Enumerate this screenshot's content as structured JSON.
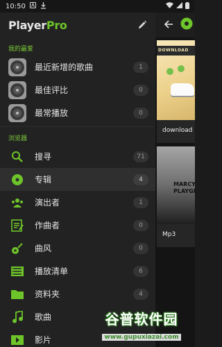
{
  "status_bar": {
    "time": "10:50"
  },
  "drawer": {
    "logo": {
      "part1": "Player",
      "part2": "Pro"
    },
    "sections": {
      "favorites_title": "我的最爱",
      "browser_title": "浏览器"
    },
    "favorites": [
      {
        "label": "最近新增的歌曲",
        "count": "1",
        "icon": "vinyl-icon"
      },
      {
        "label": "最佳评比",
        "count": "0",
        "icon": "vinyl-icon"
      },
      {
        "label": "最常播放",
        "count": "0",
        "icon": "vinyl-icon"
      }
    ],
    "browser": [
      {
        "label": "搜寻",
        "count": "71",
        "icon": "search-icon"
      },
      {
        "label": "专辑",
        "count": "4",
        "icon": "album-icon"
      },
      {
        "label": "演出者",
        "count": "1",
        "icon": "artists-icon"
      },
      {
        "label": "作曲者",
        "count": "0",
        "icon": "composer-icon"
      },
      {
        "label": "曲风",
        "count": "0",
        "icon": "guitar-icon"
      },
      {
        "label": "播放清单",
        "count": "6",
        "icon": "playlist-icon"
      },
      {
        "label": "资料夹",
        "count": "4",
        "icon": "folder-icon"
      },
      {
        "label": "歌曲",
        "count": "",
        "icon": "music-note-icon"
      },
      {
        "label": "影片",
        "count": "",
        "icon": "video-icon"
      }
    ]
  },
  "main": {
    "tiles": [
      {
        "banner": "DOWNLOAD",
        "caption": "download"
      },
      {
        "art_text": "MARCY PLAYGR",
        "caption": "Mp3"
      }
    ]
  },
  "watermark": {
    "main": "谷普软件园",
    "url": "www.gupuxiazai.com"
  },
  "colors": {
    "accent": "#6ec52a",
    "drawer_bg": "#222222",
    "active_row": "#2f2f2f"
  }
}
